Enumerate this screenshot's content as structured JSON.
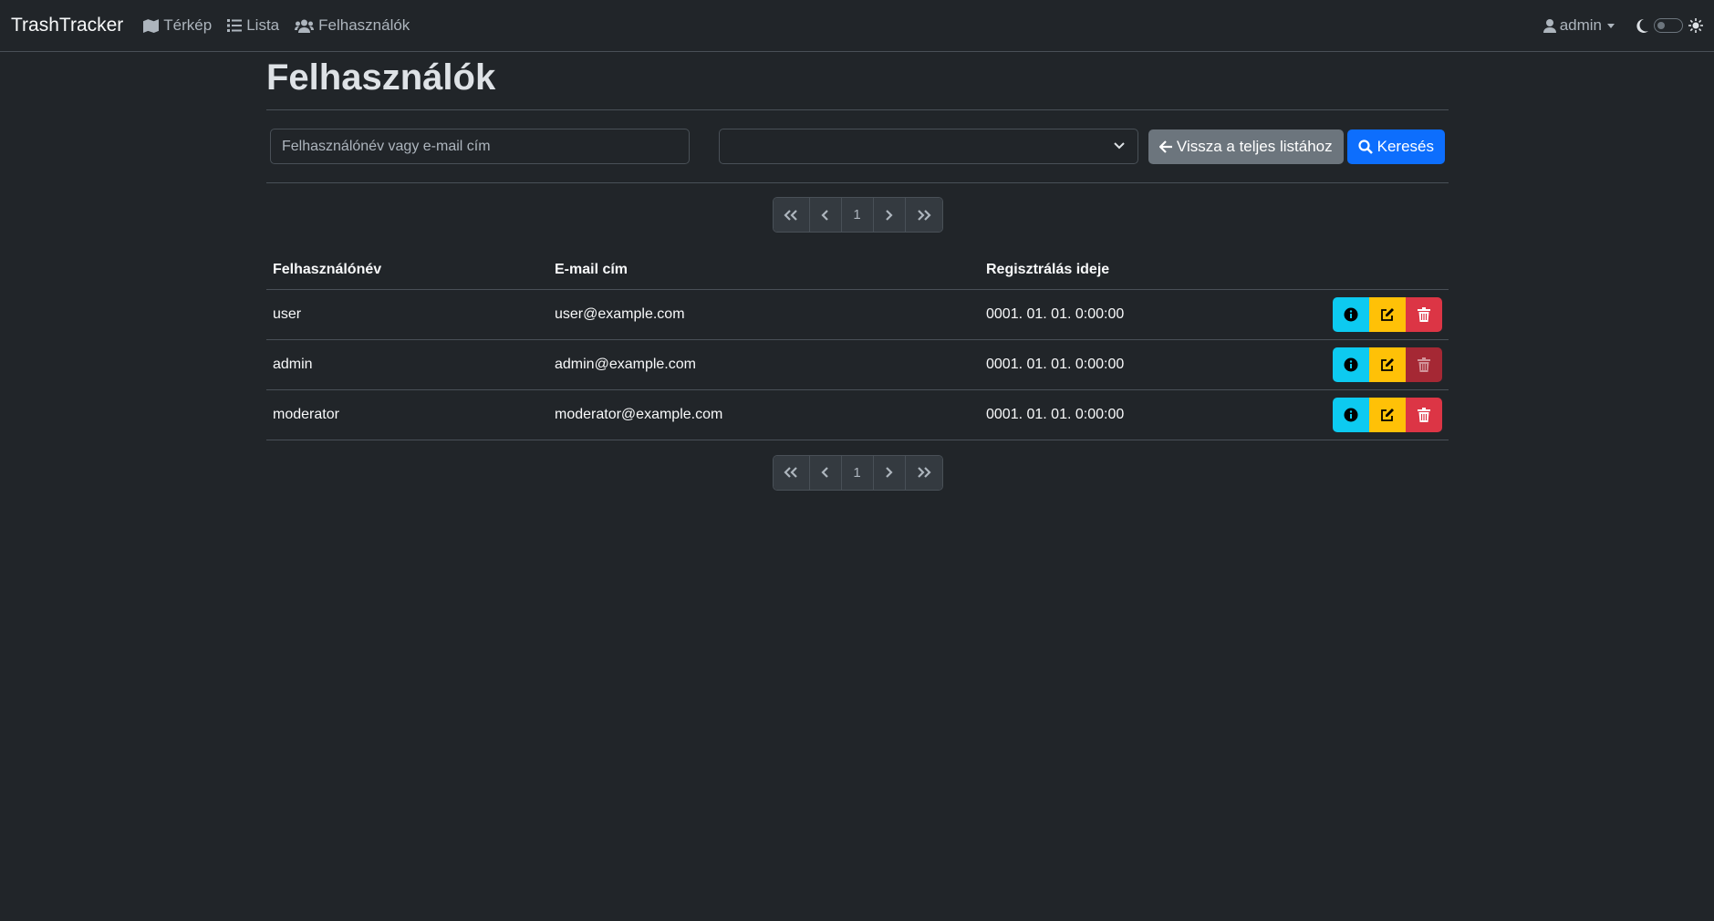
{
  "nav": {
    "brand": "TrashTracker",
    "links": [
      {
        "label": "Térkép",
        "icon": "map-icon"
      },
      {
        "label": "Lista",
        "icon": "list-icon"
      },
      {
        "label": "Felhasználók",
        "icon": "users-icon"
      }
    ],
    "user": "admin"
  },
  "page": {
    "title": "Felhasználók"
  },
  "search": {
    "placeholder": "Felhasználónév vagy e-mail cím",
    "select_value": "",
    "back_label": "Vissza a teljes listához",
    "search_label": "Keresés"
  },
  "pagination": {
    "current": "1"
  },
  "table": {
    "headers": [
      "Felhasználónév",
      "E-mail cím",
      "Regisztrálás ideje"
    ],
    "rows": [
      {
        "username": "user",
        "email": "user@example.com",
        "registered": "0001. 01. 01. 0:00:00",
        "delete_disabled": false
      },
      {
        "username": "admin",
        "email": "admin@example.com",
        "registered": "0001. 01. 01. 0:00:00",
        "delete_disabled": true
      },
      {
        "username": "moderator",
        "email": "moderator@example.com",
        "registered": "0001. 01. 01. 0:00:00",
        "delete_disabled": false
      }
    ]
  },
  "colors": {
    "background": "#212529",
    "info": "#0dcaf0",
    "warning": "#ffc107",
    "danger": "#dc3545",
    "primary": "#0d6efd",
    "secondary": "#6c757d"
  }
}
